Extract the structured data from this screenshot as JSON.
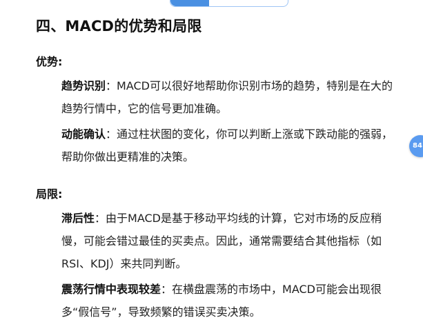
{
  "heading": "四、MACD的优势和局限",
  "advantages": {
    "label": "优势:",
    "items": [
      {
        "term": "趋势识别",
        "text": "：MACD可以很好地帮助你识别市场的趋势，特别是在大的趋势行情中，它的信号更加准确。"
      },
      {
        "term": "动能确认",
        "text": "：通过柱状图的变化，你可以判断上涨或下跌动能的强弱，帮助你做出更精准的决策。"
      }
    ]
  },
  "limitations": {
    "label": "局限:",
    "items": [
      {
        "term": "滞后性",
        "text": "：由于MACD是基于移动平均线的计算，它对市场的反应稍慢，可能会错过最佳的买卖点。因此，通常需要结合其他指标（如RSI、KDJ）来共同判断。"
      },
      {
        "term": "震荡行情中表现较差",
        "text": "：在横盘震荡的市场中，MACD可能会出现很多“假信号”，导致频繁的错误买卖决策。"
      }
    ]
  },
  "side_badge": "84",
  "colors": {
    "accent": "#4a90e2",
    "badge": "#5a9bf0"
  }
}
